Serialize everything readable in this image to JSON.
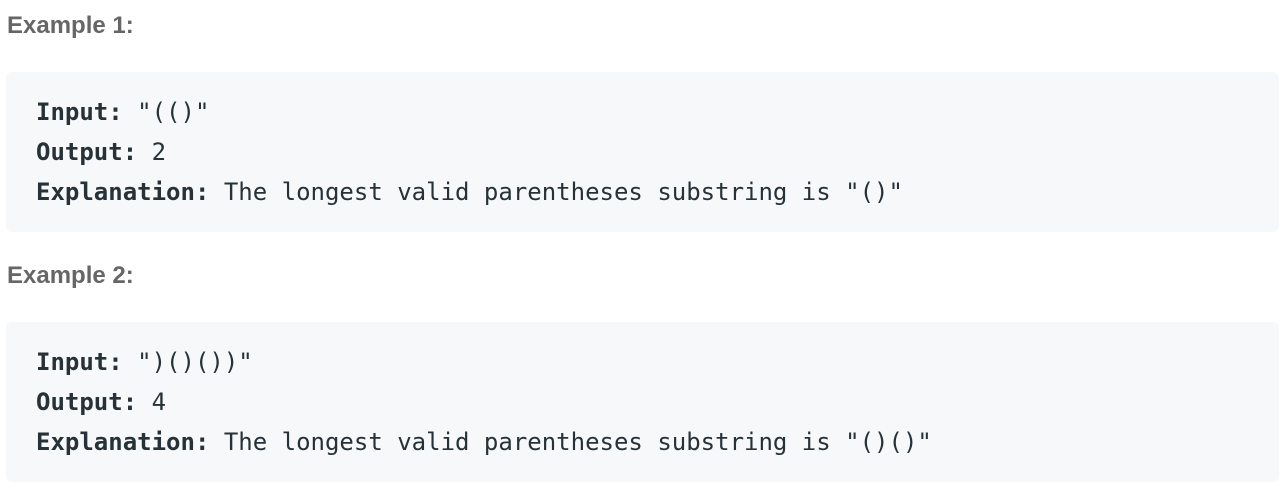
{
  "examples": [
    {
      "heading": "Example 1:",
      "input_label": "Input:",
      "input_value": " \"(()\"",
      "output_label": "Output:",
      "output_value": " 2",
      "explanation_label": "Explanation:",
      "explanation_value": " The longest valid parentheses substring is \"()\""
    },
    {
      "heading": "Example 2:",
      "input_label": "Input:",
      "input_value": " \")()())\"",
      "output_label": "Output:",
      "output_value": " 4",
      "explanation_label": "Explanation:",
      "explanation_value": " The longest valid parentheses substring is \"()()\""
    }
  ]
}
